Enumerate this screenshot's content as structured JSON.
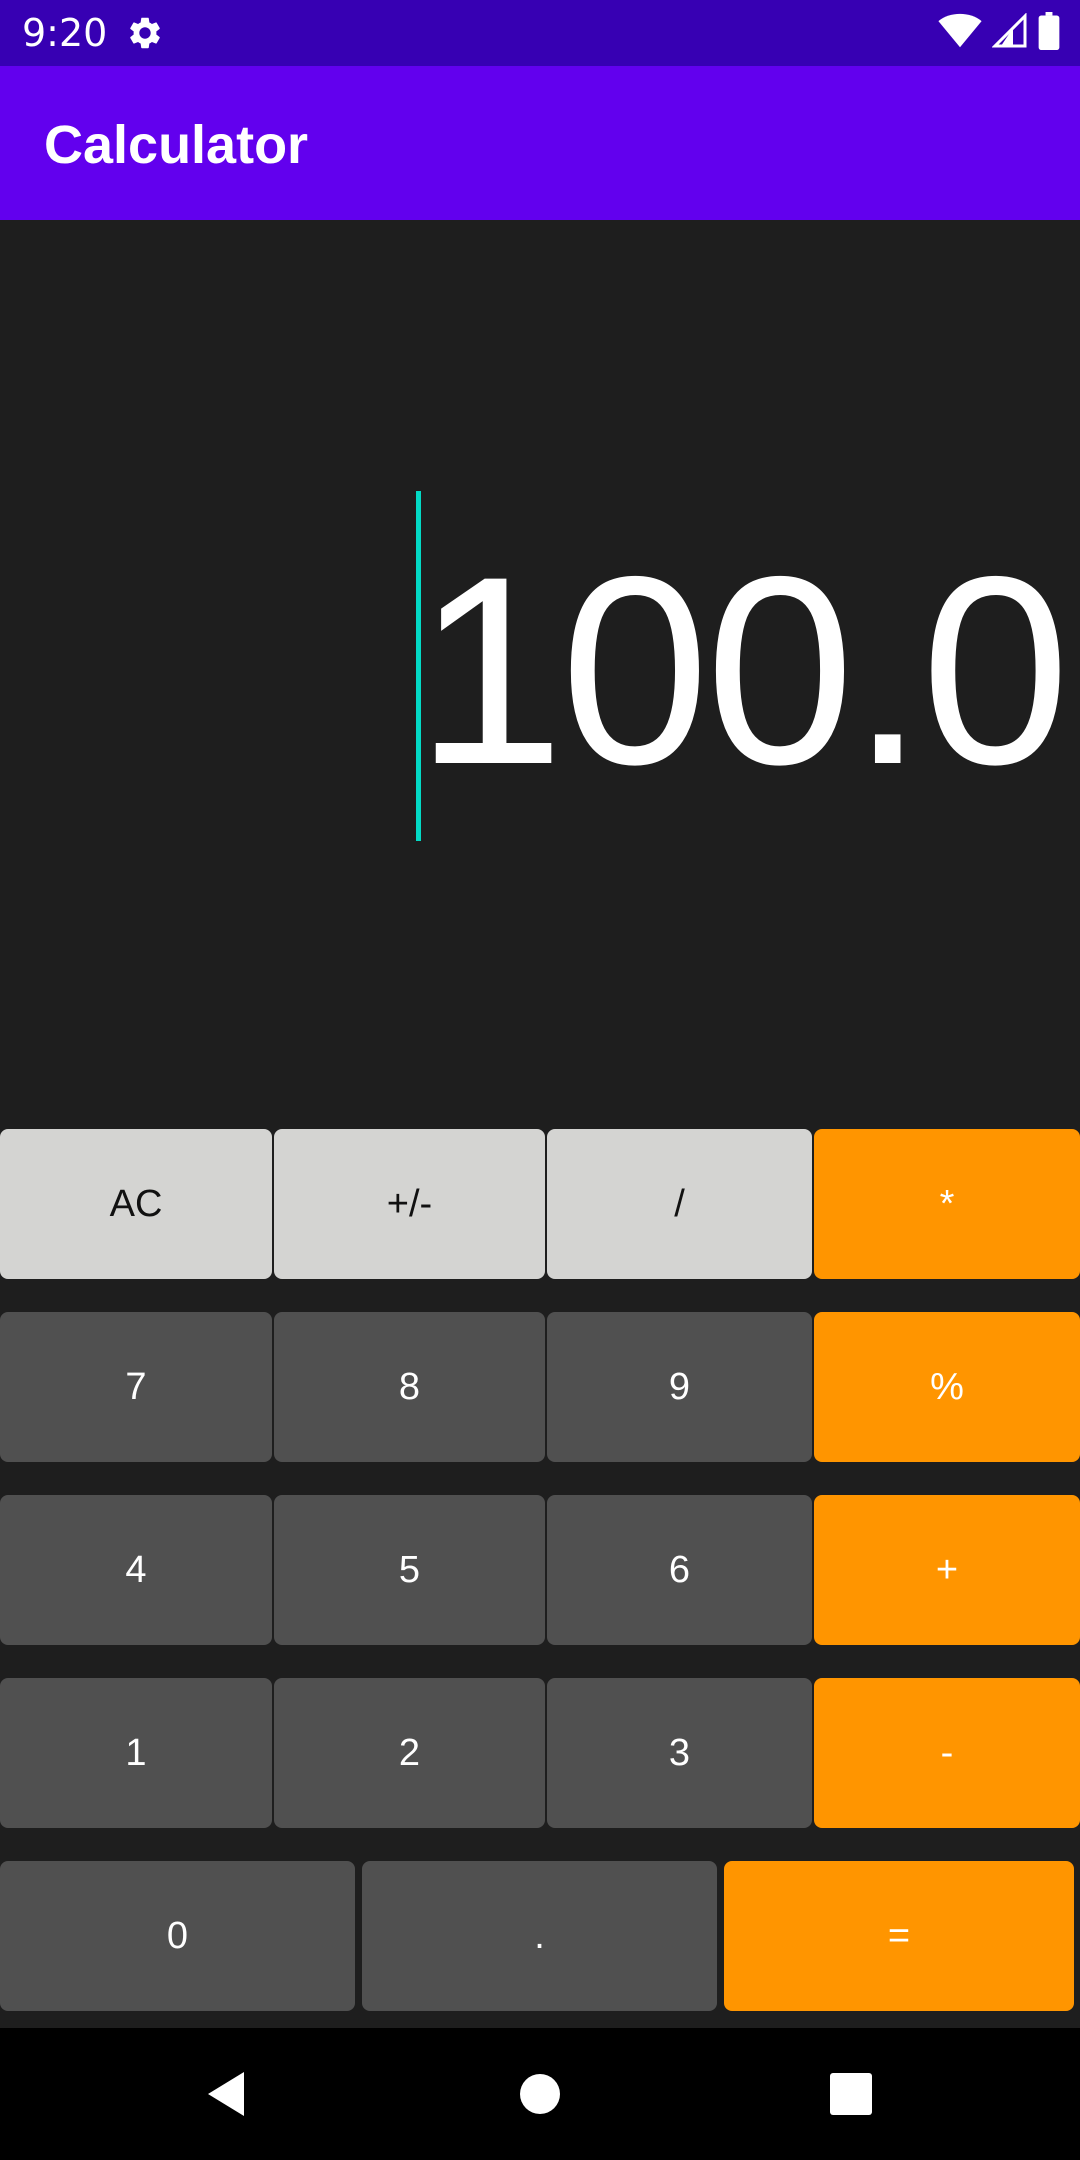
{
  "status_bar": {
    "time": "9:20",
    "icons": [
      "gear-icon",
      "wifi-icon",
      "signal-icon",
      "battery-icon"
    ]
  },
  "app_bar": {
    "title": "Calculator"
  },
  "display": {
    "value": "100.0"
  },
  "keypad": {
    "row1": [
      "AC",
      "+/-",
      "/",
      "*"
    ],
    "row2": [
      "7",
      "8",
      "9",
      "%"
    ],
    "row3": [
      "4",
      "5",
      "6",
      "+"
    ],
    "row4": [
      "1",
      "2",
      "3",
      "-"
    ],
    "row5": [
      "0",
      ".",
      "="
    ]
  },
  "nav_bar": {
    "icons": [
      "back-icon",
      "home-icon",
      "recents-icon"
    ]
  },
  "colors": {
    "status_bar": "#3700b3",
    "app_bar": "#6200ee",
    "background": "#1e1e1e",
    "function_key": "#d4d4d2",
    "digit_key": "#505050",
    "operator_key": "#ff9500",
    "cursor": "#03dac5"
  }
}
